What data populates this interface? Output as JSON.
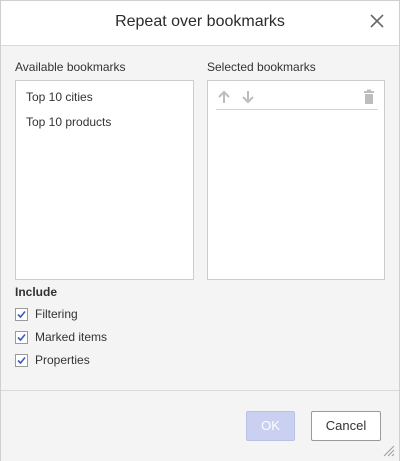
{
  "dialog": {
    "title": "Repeat over bookmarks",
    "close_icon": "close-icon"
  },
  "available": {
    "label": "Available bookmarks",
    "items": [
      "Top 10 cities",
      "Top 10 products"
    ]
  },
  "selected": {
    "label": "Selected bookmarks",
    "items": [],
    "toolbar_icons": [
      "arrow-up-icon",
      "arrow-down-icon",
      "trash-icon"
    ]
  },
  "include": {
    "title": "Include",
    "options": [
      {
        "label": "Filtering",
        "checked": true
      },
      {
        "label": "Marked items",
        "checked": true
      },
      {
        "label": "Properties",
        "checked": true
      }
    ]
  },
  "footer": {
    "ok_label": "OK",
    "cancel_label": "Cancel",
    "resize_icon": "resize-grip-icon"
  },
  "colors": {
    "ok_button_disabled": "#c9d0f0",
    "checkbox_check": "#3b5bbf"
  }
}
